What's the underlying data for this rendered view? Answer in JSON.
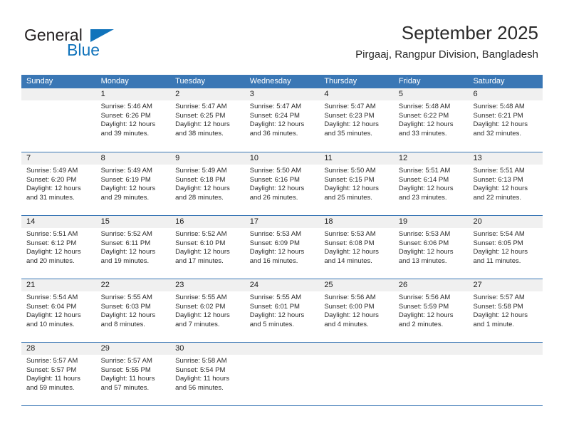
{
  "brand": {
    "name_part1": "General",
    "name_part2": "Blue",
    "accent_color": "#1073bb"
  },
  "header": {
    "title": "September 2025",
    "subtitle": "Pirgaaj, Rangpur Division, Bangladesh"
  },
  "theme": {
    "header_blue": "#3a77b5",
    "day_band_gray": "#f0f0f0"
  },
  "weekdays": [
    "Sunday",
    "Monday",
    "Tuesday",
    "Wednesday",
    "Thursday",
    "Friday",
    "Saturday"
  ],
  "weeks": [
    [
      {
        "day": "",
        "lines": []
      },
      {
        "day": "1",
        "lines": [
          "Sunrise: 5:46 AM",
          "Sunset: 6:26 PM",
          "Daylight: 12 hours",
          "and 39 minutes."
        ]
      },
      {
        "day": "2",
        "lines": [
          "Sunrise: 5:47 AM",
          "Sunset: 6:25 PM",
          "Daylight: 12 hours",
          "and 38 minutes."
        ]
      },
      {
        "day": "3",
        "lines": [
          "Sunrise: 5:47 AM",
          "Sunset: 6:24 PM",
          "Daylight: 12 hours",
          "and 36 minutes."
        ]
      },
      {
        "day": "4",
        "lines": [
          "Sunrise: 5:47 AM",
          "Sunset: 6:23 PM",
          "Daylight: 12 hours",
          "and 35 minutes."
        ]
      },
      {
        "day": "5",
        "lines": [
          "Sunrise: 5:48 AM",
          "Sunset: 6:22 PM",
          "Daylight: 12 hours",
          "and 33 minutes."
        ]
      },
      {
        "day": "6",
        "lines": [
          "Sunrise: 5:48 AM",
          "Sunset: 6:21 PM",
          "Daylight: 12 hours",
          "and 32 minutes."
        ]
      }
    ],
    [
      {
        "day": "7",
        "lines": [
          "Sunrise: 5:49 AM",
          "Sunset: 6:20 PM",
          "Daylight: 12 hours",
          "and 31 minutes."
        ]
      },
      {
        "day": "8",
        "lines": [
          "Sunrise: 5:49 AM",
          "Sunset: 6:19 PM",
          "Daylight: 12 hours",
          "and 29 minutes."
        ]
      },
      {
        "day": "9",
        "lines": [
          "Sunrise: 5:49 AM",
          "Sunset: 6:18 PM",
          "Daylight: 12 hours",
          "and 28 minutes."
        ]
      },
      {
        "day": "10",
        "lines": [
          "Sunrise: 5:50 AM",
          "Sunset: 6:16 PM",
          "Daylight: 12 hours",
          "and 26 minutes."
        ]
      },
      {
        "day": "11",
        "lines": [
          "Sunrise: 5:50 AM",
          "Sunset: 6:15 PM",
          "Daylight: 12 hours",
          "and 25 minutes."
        ]
      },
      {
        "day": "12",
        "lines": [
          "Sunrise: 5:51 AM",
          "Sunset: 6:14 PM",
          "Daylight: 12 hours",
          "and 23 minutes."
        ]
      },
      {
        "day": "13",
        "lines": [
          "Sunrise: 5:51 AM",
          "Sunset: 6:13 PM",
          "Daylight: 12 hours",
          "and 22 minutes."
        ]
      }
    ],
    [
      {
        "day": "14",
        "lines": [
          "Sunrise: 5:51 AM",
          "Sunset: 6:12 PM",
          "Daylight: 12 hours",
          "and 20 minutes."
        ]
      },
      {
        "day": "15",
        "lines": [
          "Sunrise: 5:52 AM",
          "Sunset: 6:11 PM",
          "Daylight: 12 hours",
          "and 19 minutes."
        ]
      },
      {
        "day": "16",
        "lines": [
          "Sunrise: 5:52 AM",
          "Sunset: 6:10 PM",
          "Daylight: 12 hours",
          "and 17 minutes."
        ]
      },
      {
        "day": "17",
        "lines": [
          "Sunrise: 5:53 AM",
          "Sunset: 6:09 PM",
          "Daylight: 12 hours",
          "and 16 minutes."
        ]
      },
      {
        "day": "18",
        "lines": [
          "Sunrise: 5:53 AM",
          "Sunset: 6:08 PM",
          "Daylight: 12 hours",
          "and 14 minutes."
        ]
      },
      {
        "day": "19",
        "lines": [
          "Sunrise: 5:53 AM",
          "Sunset: 6:06 PM",
          "Daylight: 12 hours",
          "and 13 minutes."
        ]
      },
      {
        "day": "20",
        "lines": [
          "Sunrise: 5:54 AM",
          "Sunset: 6:05 PM",
          "Daylight: 12 hours",
          "and 11 minutes."
        ]
      }
    ],
    [
      {
        "day": "21",
        "lines": [
          "Sunrise: 5:54 AM",
          "Sunset: 6:04 PM",
          "Daylight: 12 hours",
          "and 10 minutes."
        ]
      },
      {
        "day": "22",
        "lines": [
          "Sunrise: 5:55 AM",
          "Sunset: 6:03 PM",
          "Daylight: 12 hours",
          "and 8 minutes."
        ]
      },
      {
        "day": "23",
        "lines": [
          "Sunrise: 5:55 AM",
          "Sunset: 6:02 PM",
          "Daylight: 12 hours",
          "and 7 minutes."
        ]
      },
      {
        "day": "24",
        "lines": [
          "Sunrise: 5:55 AM",
          "Sunset: 6:01 PM",
          "Daylight: 12 hours",
          "and 5 minutes."
        ]
      },
      {
        "day": "25",
        "lines": [
          "Sunrise: 5:56 AM",
          "Sunset: 6:00 PM",
          "Daylight: 12 hours",
          "and 4 minutes."
        ]
      },
      {
        "day": "26",
        "lines": [
          "Sunrise: 5:56 AM",
          "Sunset: 5:59 PM",
          "Daylight: 12 hours",
          "and 2 minutes."
        ]
      },
      {
        "day": "27",
        "lines": [
          "Sunrise: 5:57 AM",
          "Sunset: 5:58 PM",
          "Daylight: 12 hours",
          "and 1 minute."
        ]
      }
    ],
    [
      {
        "day": "28",
        "lines": [
          "Sunrise: 5:57 AM",
          "Sunset: 5:57 PM",
          "Daylight: 11 hours",
          "and 59 minutes."
        ]
      },
      {
        "day": "29",
        "lines": [
          "Sunrise: 5:57 AM",
          "Sunset: 5:55 PM",
          "Daylight: 11 hours",
          "and 57 minutes."
        ]
      },
      {
        "day": "30",
        "lines": [
          "Sunrise: 5:58 AM",
          "Sunset: 5:54 PM",
          "Daylight: 11 hours",
          "and 56 minutes."
        ]
      },
      {
        "day": "",
        "lines": []
      },
      {
        "day": "",
        "lines": []
      },
      {
        "day": "",
        "lines": []
      },
      {
        "day": "",
        "lines": []
      }
    ]
  ]
}
